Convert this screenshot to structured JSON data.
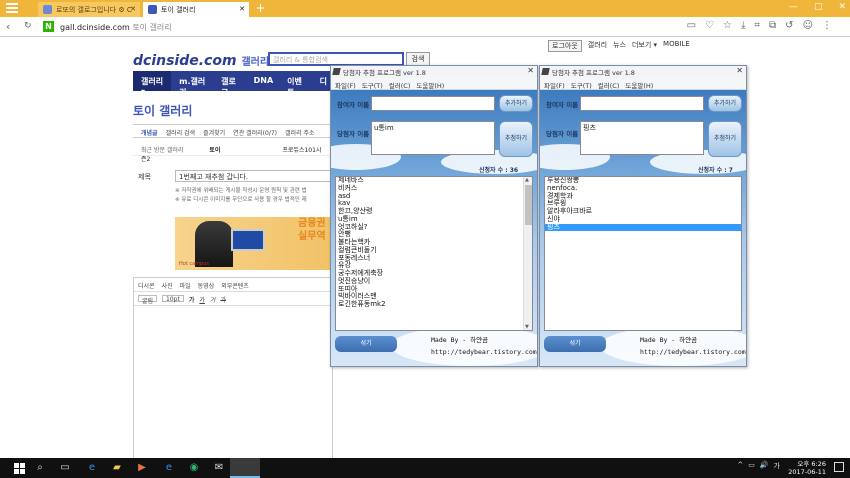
{
  "browser": {
    "tabs": [
      {
        "label": "토이 갤러리",
        "active": false
      },
      {
        "label": "토이 갤러리",
        "active": true
      }
    ],
    "tab1_label": "로또의 갤로그입니다 ⚙ C",
    "tab2_label": "토이 갤러리",
    "url_domain": "gall.dcinside.com",
    "url_title": "토이 갤러리"
  },
  "site": {
    "toplinks": [
      "로그아웃",
      "갤러리",
      "뉴스",
      "더보기 ▾",
      "MOBILE"
    ],
    "logo": "dcinside.com",
    "logo_suffix": "갤러리",
    "search_placeholder": "갤러리 & 통합검색",
    "search_button": "검색",
    "gnb": [
      "갤러리 ▾",
      "m.갤러리",
      "갤로그",
      "DNA",
      "이벤트",
      "디"
    ],
    "gallery_title": "토이 갤러리",
    "subtabs": [
      "개념글",
      "갤러리 검색",
      "즐겨찾기",
      "연관 갤러리(0/7)",
      "갤러리 주소"
    ],
    "recent_label": "최근 방문 갤러리",
    "recent_item1": "토이",
    "recent_item2": "프로듀스101시즌2",
    "title_label": "제목",
    "title_value": "1번째고 재추첨 갑니다.",
    "notice_line1": "※ 저작권에 위배되는 게시물 작성시 운영 원칙 및 관련 법",
    "notice_line2": "※ 유료 디시콘 이미지를 무단으로 사용 할 경우 법적인 제",
    "banner_brand": "Hot campus",
    "banner_text_line1": "금융권",
    "banner_text_line2": "실무역",
    "editor_tools1": [
      "디시콘",
      "사진",
      "파일",
      "동영상",
      "외부콘텐츠"
    ],
    "editor_font": "굴림",
    "editor_size": "10pt",
    "editor_tools2": [
      "가",
      "가",
      "가",
      "가"
    ]
  },
  "programs": [
    {
      "title": "당첨자 추첨 프로그램 ver 1.8",
      "menu": [
        "파일(F)",
        "도구(T)",
        "컬러(C)",
        "도움말(H)"
      ],
      "participant_label": "참여자 이름",
      "participant_value": "",
      "winner_label": "당첨자 이름",
      "winner_value": "u통im",
      "add_button": "추가하기",
      "draw_button": "추첨하기",
      "count_label": "신청자 수 : 36",
      "list": [
        "제네바스",
        "비커스",
        "asd",
        "kav",
        "한끄,양산령",
        "u통im",
        "엇코하실?",
        "안뻥",
        "불타는핵카",
        "컬럼큰비둘기",
        "포동레스너",
        "유강",
        "궁수저에게축장",
        "멋진승냥이",
        "또띠아",
        "빅바이러스맨",
        "로긴한퓨동mk2"
      ],
      "selected_index": -1,
      "made_by": "Made By - 하얀곰",
      "site": "http://tedybear.tistory.com",
      "shuffle_button": "섞기"
    },
    {
      "title": "당첨자 추첨 프로그램 ver 1.8",
      "menu": [
        "파일(F)",
        "도구(T)",
        "컬러(C)",
        "도움말(H)"
      ],
      "participant_label": "참여자 이름",
      "participant_value": "",
      "winner_label": "당첨자 이름",
      "winner_value": "핑츠",
      "add_button": "추가하기",
      "draw_button": "추첨하기",
      "count_label": "신청자 수 : 7",
      "list": [
        "루용진짱뽕",
        "nenfoca.",
        "경제학과",
        "브루윙",
        "알라후아크바르",
        "신야",
        "핑츠"
      ],
      "selected_index": 6,
      "made_by": "Made By - 하얀곰",
      "site": "http://tedybear.tistory.com",
      "shuffle_button": "섞기"
    }
  ],
  "taskbar": {
    "tray": [
      "^",
      "▭",
      "🔊",
      "가"
    ],
    "time": "오후 6:26",
    "date": "2017-06-11"
  },
  "colors": {
    "browser_tab": "#f0b63c",
    "gnb": "#2a3d8f",
    "selection": "#3399ff"
  }
}
